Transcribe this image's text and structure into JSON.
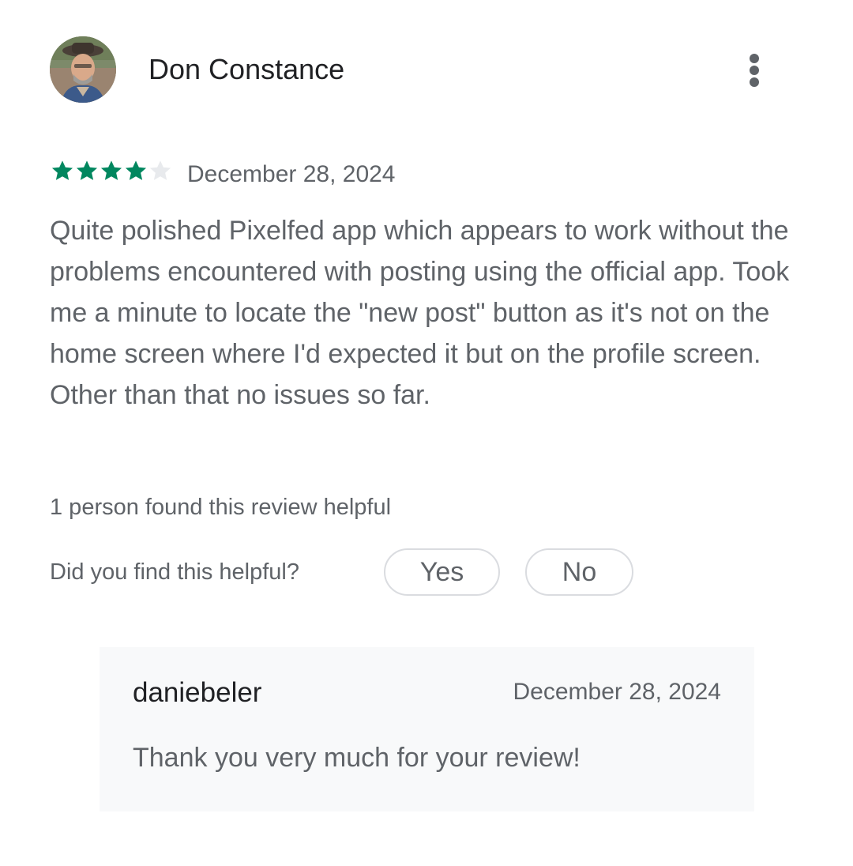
{
  "review": {
    "author": "Don Constance",
    "avatar_icon": "user-photo-avatar",
    "menu_icon": "more-vert-icon",
    "rating": 4,
    "rating_max": 5,
    "star_color": "#01875f",
    "star_empty_color": "#e8eaed",
    "date": "December 28, 2024",
    "body": "Quite polished Pixelfed app which appears to work without the problems encountered with posting using the official app. Took me a minute to locate the \"new post\" button as it's not on the home screen where I'd expected it but on the profile screen. Other than that no issues so far.",
    "helpful_count_text": "1 person found this review helpful"
  },
  "feedback": {
    "question": "Did you find this helpful?",
    "yes_label": "Yes",
    "no_label": "No"
  },
  "reply": {
    "author": "daniebeler",
    "date": "December 28, 2024",
    "text": "Thank you very much for your review!"
  }
}
